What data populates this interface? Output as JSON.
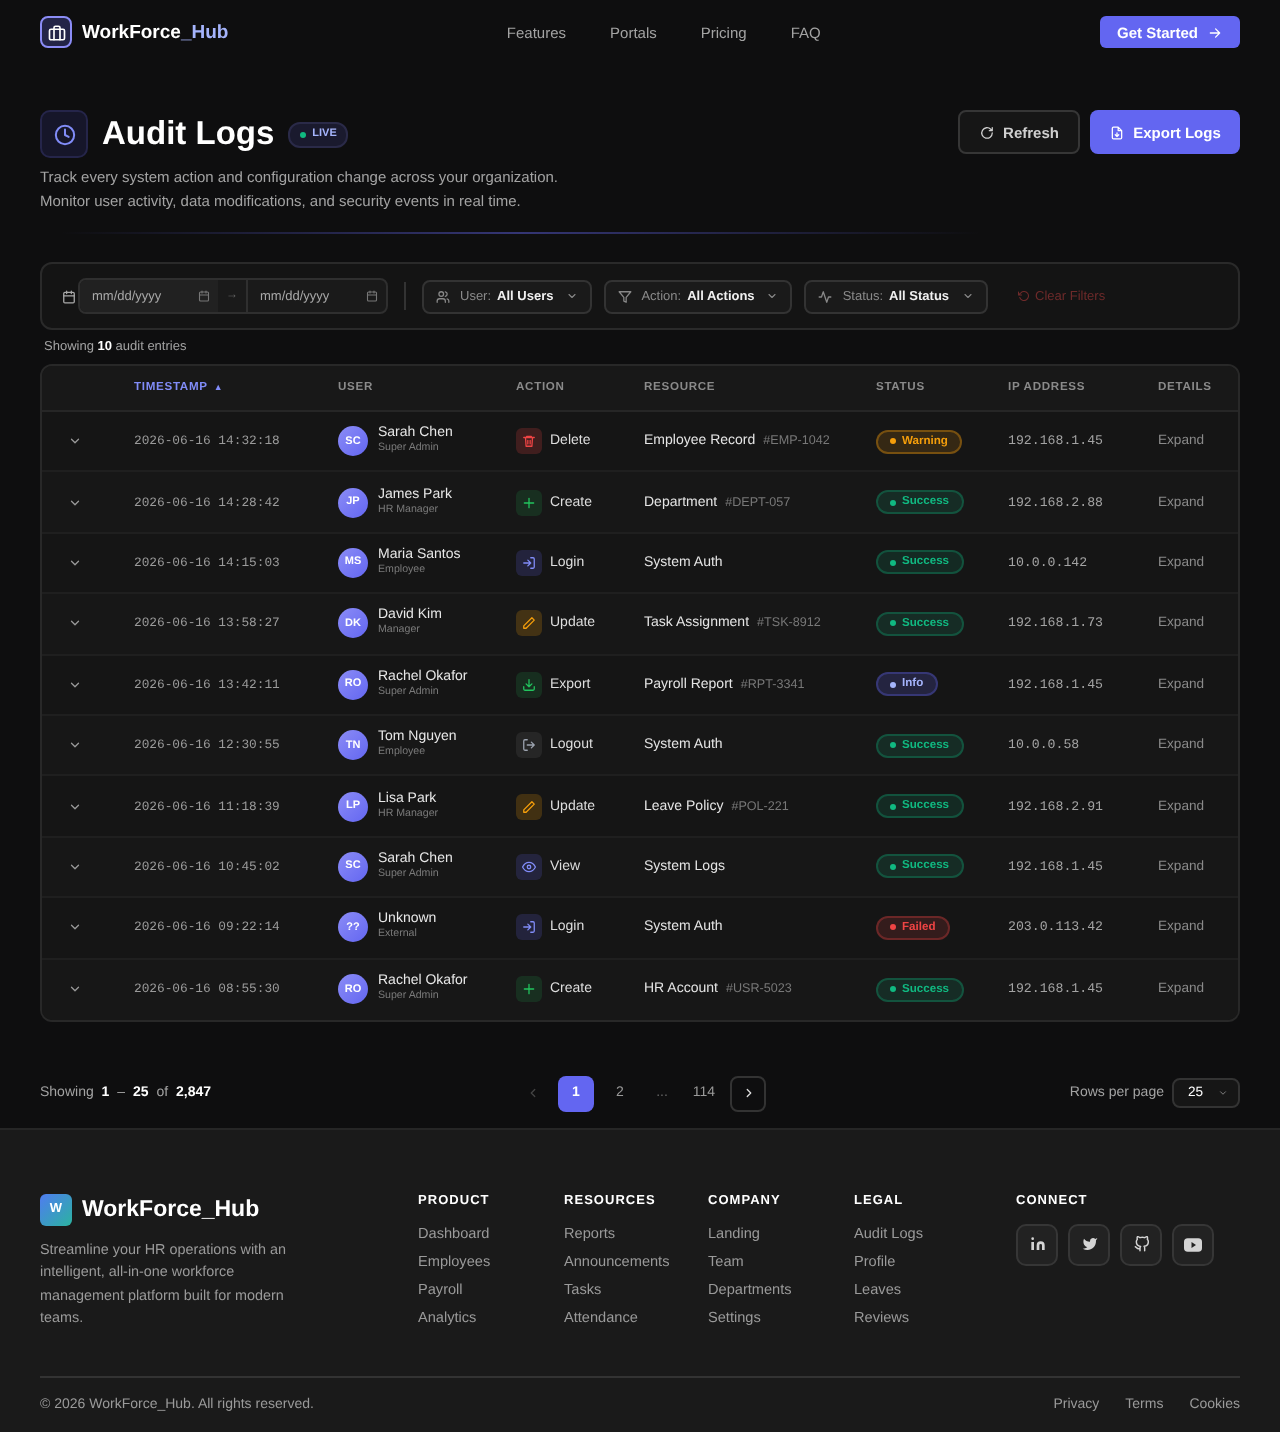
{
  "nav": {
    "brand": {
      "name": "WorkForce",
      "name_accent": "_Hub"
    },
    "links": [
      "Features",
      "Portals",
      "Pricing",
      "FAQ"
    ],
    "cta": "Get Started"
  },
  "header": {
    "title": "Audit Logs",
    "badge": "LIVE",
    "description": "Track every system action and configuration change across your organization. Monitor user activity, data modifications, and security events in real time.",
    "refresh_button": "Refresh",
    "export_button": "Export Logs"
  },
  "filters": {
    "date_from": {
      "placeholder": "mm/dd/yyyy"
    },
    "range_arrow": "→",
    "date_to": {
      "placeholder": "mm/dd/yyyy"
    },
    "dropdowns": [
      {
        "kind": "user",
        "label": "User:",
        "value": "All Users"
      },
      {
        "kind": "action",
        "label": "Action:",
        "value": "All Actions"
      },
      {
        "kind": "status",
        "label": "Status:",
        "value": "All Status"
      }
    ],
    "clear": {
      "label": "Clear Filters",
      "disabled": true
    }
  },
  "summary": "Showing **10** audit entries",
  "table": {
    "columns": [
      {
        "label": "TIMESTAMP",
        "sorted": true,
        "arrow": "▲"
      },
      {
        "label": "USER",
        "sorted": false
      },
      {
        "label": "ACTION",
        "sorted": false
      },
      {
        "label": "RESOURCE",
        "sorted": false
      },
      {
        "label": "STATUS",
        "sorted": false
      },
      {
        "label": "IP ADDRESS",
        "sorted": false
      },
      {
        "label": "DETAILS",
        "sorted": false
      }
    ],
    "rows": [
      {
        "expanded": false,
        "timestamp": "2026-06-16 14:32:18",
        "user": {
          "initials": "SC",
          "name": "Sarah Chen",
          "role": "Super Admin"
        },
        "action": {
          "kind": "delete",
          "label": "Delete"
        },
        "resource": {
          "name": "Employee Record",
          "ref": "#EMP-1042"
        },
        "status": {
          "kind": "warning",
          "label": "Warning"
        },
        "ip": "192.168.1.45",
        "details": "Expand"
      },
      {
        "expanded": false,
        "timestamp": "2026-06-16 14:28:42",
        "user": {
          "initials": "JP",
          "name": "James Park",
          "role": "HR Manager"
        },
        "action": {
          "kind": "create",
          "label": "Create"
        },
        "resource": {
          "name": "Department",
          "ref": "#DEPT-057"
        },
        "status": {
          "kind": "success",
          "label": "Success"
        },
        "ip": "192.168.2.88",
        "details": "Expand"
      },
      {
        "expanded": false,
        "timestamp": "2026-06-16 14:15:03",
        "user": {
          "initials": "MS",
          "name": "Maria Santos",
          "role": "Employee"
        },
        "action": {
          "kind": "login",
          "label": "Login"
        },
        "resource": {
          "name": "System Auth"
        },
        "status": {
          "kind": "success",
          "label": "Success"
        },
        "ip": "10.0.0.142",
        "details": "Expand"
      },
      {
        "expanded": false,
        "timestamp": "2026-06-16 13:58:27",
        "user": {
          "initials": "DK",
          "name": "David Kim",
          "role": "Manager"
        },
        "action": {
          "kind": "update",
          "label": "Update"
        },
        "resource": {
          "name": "Task Assignment",
          "ref": "#TSK-8912"
        },
        "status": {
          "kind": "success",
          "label": "Success"
        },
        "ip": "192.168.1.73",
        "details": "Expand"
      },
      {
        "expanded": false,
        "timestamp": "2026-06-16 13:42:11",
        "user": {
          "initials": "RO",
          "name": "Rachel Okafor",
          "role": "Super Admin"
        },
        "action": {
          "kind": "export",
          "label": "Export"
        },
        "resource": {
          "name": "Payroll Report",
          "ref": "#RPT-3341"
        },
        "status": {
          "kind": "info",
          "label": "Info"
        },
        "ip": "192.168.1.45",
        "details": "Expand"
      },
      {
        "expanded": false,
        "timestamp": "2026-06-16 12:30:55",
        "user": {
          "initials": "TN",
          "name": "Tom Nguyen",
          "role": "Employee"
        },
        "action": {
          "kind": "logout",
          "label": "Logout"
        },
        "resource": {
          "name": "System Auth"
        },
        "status": {
          "kind": "success",
          "label": "Success"
        },
        "ip": "10.0.0.58",
        "details": "Expand"
      },
      {
        "expanded": false,
        "timestamp": "2026-06-16 11:18:39",
        "user": {
          "initials": "LP",
          "name": "Lisa Park",
          "role": "HR Manager"
        },
        "action": {
          "kind": "update",
          "label": "Update"
        },
        "resource": {
          "name": "Leave Policy",
          "ref": "#POL-221"
        },
        "status": {
          "kind": "success",
          "label": "Success"
        },
        "ip": "192.168.2.91",
        "details": "Expand"
      },
      {
        "expanded": false,
        "timestamp": "2026-06-16 10:45:02",
        "user": {
          "initials": "SC",
          "name": "Sarah Chen",
          "role": "Super Admin"
        },
        "action": {
          "kind": "view",
          "label": "View"
        },
        "resource": {
          "name": "System Logs"
        },
        "status": {
          "kind": "success",
          "label": "Success"
        },
        "ip": "192.168.1.45",
        "details": "Expand"
      },
      {
        "expanded": false,
        "timestamp": "2026-06-16 09:22:14",
        "user": {
          "initials": "??",
          "name": "Unknown",
          "role": "External"
        },
        "action": {
          "kind": "login",
          "label": "Login"
        },
        "resource": {
          "name": "System Auth"
        },
        "status": {
          "kind": "failed",
          "label": "Failed"
        },
        "ip": "203.0.113.42",
        "details": "Expand"
      },
      {
        "expanded": false,
        "timestamp": "2026-06-16 08:55:30",
        "user": {
          "initials": "RO",
          "name": "Rachel Okafor",
          "role": "Super Admin"
        },
        "action": {
          "kind": "create",
          "label": "Create"
        },
        "resource": {
          "name": "HR Account",
          "ref": "#USR-5023"
        },
        "status": {
          "kind": "success",
          "label": "Success"
        },
        "ip": "192.168.1.45",
        "details": "Expand"
      }
    ]
  },
  "pagination": {
    "summary": "Showing **1** – **25** of **2,847**",
    "prev": {
      "disabled": true
    },
    "pages": [
      {
        "label": "1",
        "kind": "page",
        "selected": true
      },
      {
        "label": "2",
        "kind": "page",
        "selected": false
      },
      {
        "label": "...",
        "kind": "ellipsis",
        "selected": false
      },
      {
        "label": "114",
        "kind": "page",
        "selected": false
      }
    ],
    "next": {
      "disabled": false
    },
    "rows_per_page": {
      "label": "Rows per page",
      "value": "25"
    }
  },
  "footer": {
    "brand": {
      "logo": "W",
      "name": "WorkForce_Hub",
      "description": "Streamline your HR operations with an intelligent, all-in-one workforce management platform built for modern teams."
    },
    "columns": [
      {
        "heading": "PRODUCT",
        "links": [
          "Dashboard",
          "Employees",
          "Payroll",
          "Analytics"
        ]
      },
      {
        "heading": "RESOURCES",
        "links": [
          "Reports",
          "Announcements",
          "Tasks",
          "Attendance"
        ]
      },
      {
        "heading": "COMPANY",
        "links": [
          "Landing",
          "Team",
          "Departments",
          "Settings"
        ]
      },
      {
        "heading": "LEGAL",
        "links": [
          "Audit Logs",
          "Profile",
          "Leaves",
          "Reviews"
        ]
      }
    ],
    "connect": {
      "heading": "CONNECT",
      "socials": [
        {
          "kind": "linkedin"
        },
        {
          "kind": "twitter"
        },
        {
          "kind": "github"
        },
        {
          "kind": "youtube"
        }
      ]
    },
    "copyright": "© 2026 WorkForce_Hub. All rights reserved.",
    "legal_links": [
      "Privacy",
      "Terms",
      "Cookies"
    ]
  }
}
